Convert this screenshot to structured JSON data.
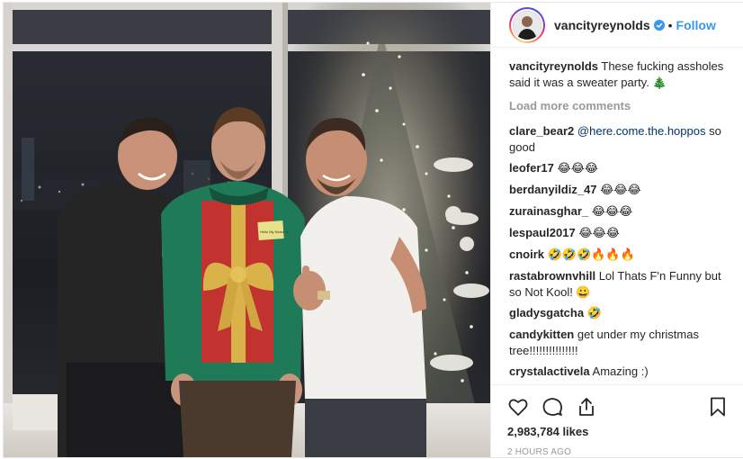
{
  "post": {
    "username": "vancityreynolds",
    "follow_label": "Follow",
    "dot": "•",
    "verified_icon": "verified-badge-icon",
    "accent_color": "#3897f0"
  },
  "caption": {
    "user": "vancityreynolds",
    "text": "These fucking assholes said it was a sweater party. 🎄"
  },
  "load_more": "Load more comments",
  "comments": [
    {
      "user": "clare_bear2",
      "mention": "@here.come.the.hoppos",
      "text": " so good"
    },
    {
      "user": "leofer17",
      "text": "😂😂😂"
    },
    {
      "user": "berdanyildiz_47",
      "text": "😂😂😂"
    },
    {
      "user": "zurainasghar_",
      "text": "😂😂😂"
    },
    {
      "user": "lespaul2017",
      "text": "😂😂😂"
    },
    {
      "user": "cnoirk",
      "text": "🤣🤣🤣🔥🔥🔥"
    },
    {
      "user": "rastabrownvhill",
      "text": "Lol Thats F'n Funny but so Not Kool! 😀"
    },
    {
      "user": "gladysgatcha",
      "text": "🤣"
    },
    {
      "user": "candykitten",
      "text": "get under my christmas tree!!!!!!!!!!!!!!!"
    },
    {
      "user": "crystalactivela",
      "text": "Amazing :)"
    }
  ],
  "likes": "2,983,784 likes",
  "time": "2 HOURS AGO",
  "sweater_tag": "Hello My Name Is"
}
